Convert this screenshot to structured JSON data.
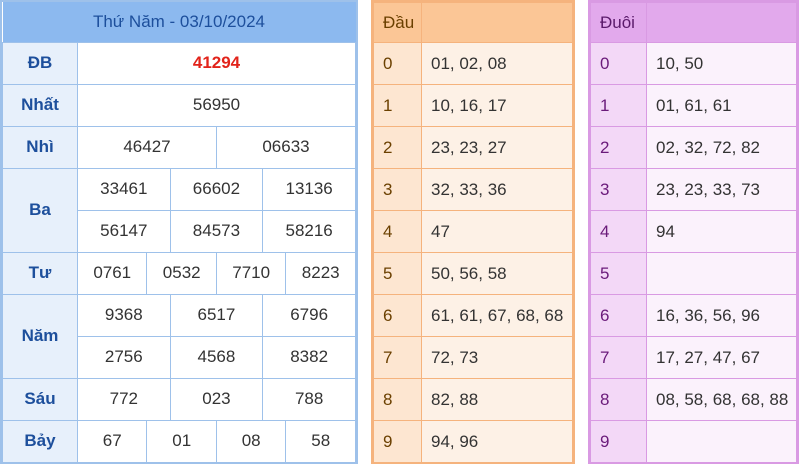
{
  "results": {
    "title_prefix": "Thứ Năm - ",
    "title_date": "03/10/2024",
    "prizes": {
      "db": {
        "label": "ĐB",
        "values": [
          "41294"
        ]
      },
      "nhat": {
        "label": "Nhất",
        "values": [
          "56950"
        ]
      },
      "nhi": {
        "label": "Nhì",
        "values": [
          "46427",
          "06633"
        ]
      },
      "ba": {
        "label": "Ba",
        "values": [
          "33461",
          "66602",
          "13136",
          "56147",
          "84573",
          "58216"
        ]
      },
      "tu": {
        "label": "Tư",
        "values": [
          "0761",
          "0532",
          "7710",
          "8223"
        ]
      },
      "nam": {
        "label": "Năm",
        "values": [
          "9368",
          "6517",
          "6796",
          "2756",
          "4568",
          "8382"
        ]
      },
      "sau": {
        "label": "Sáu",
        "values": [
          "772",
          "023",
          "788"
        ]
      },
      "bay": {
        "label": "Bảy",
        "values": [
          "67",
          "01",
          "08",
          "58"
        ]
      }
    },
    "colors": {
      "header_bg": "#8cb9ef",
      "special_red": "#e2231a",
      "label_blue": "#1d4f9c"
    }
  },
  "dau": {
    "title": "Đầu",
    "rows": [
      {
        "key": "0",
        "values": "01, 02, 08"
      },
      {
        "key": "1",
        "values": "10, 16, 17"
      },
      {
        "key": "2",
        "values": "23, 23, 27"
      },
      {
        "key": "3",
        "values": "32, 33, 36"
      },
      {
        "key": "4",
        "values": "47"
      },
      {
        "key": "5",
        "values": "50, 56, 58"
      },
      {
        "key": "6",
        "values": "61, 61, 67, 68, 68"
      },
      {
        "key": "7",
        "values": "72, 73"
      },
      {
        "key": "8",
        "values": "82, 88"
      },
      {
        "key": "9",
        "values": "94, 96"
      }
    ]
  },
  "duoi": {
    "title": "Đuôi",
    "rows": [
      {
        "key": "0",
        "values": "10, 50"
      },
      {
        "key": "1",
        "values": "01, 61, 61"
      },
      {
        "key": "2",
        "values": "02, 32, 72, 82"
      },
      {
        "key": "3",
        "values": "23, 23, 33, 73"
      },
      {
        "key": "4",
        "values": "94"
      },
      {
        "key": "5",
        "values": ""
      },
      {
        "key": "6",
        "values": "16, 36, 56, 96"
      },
      {
        "key": "7",
        "values": "17, 27, 47, 67"
      },
      {
        "key": "8",
        "values": "08, 58, 68, 68, 88"
      },
      {
        "key": "9",
        "values": ""
      }
    ]
  }
}
